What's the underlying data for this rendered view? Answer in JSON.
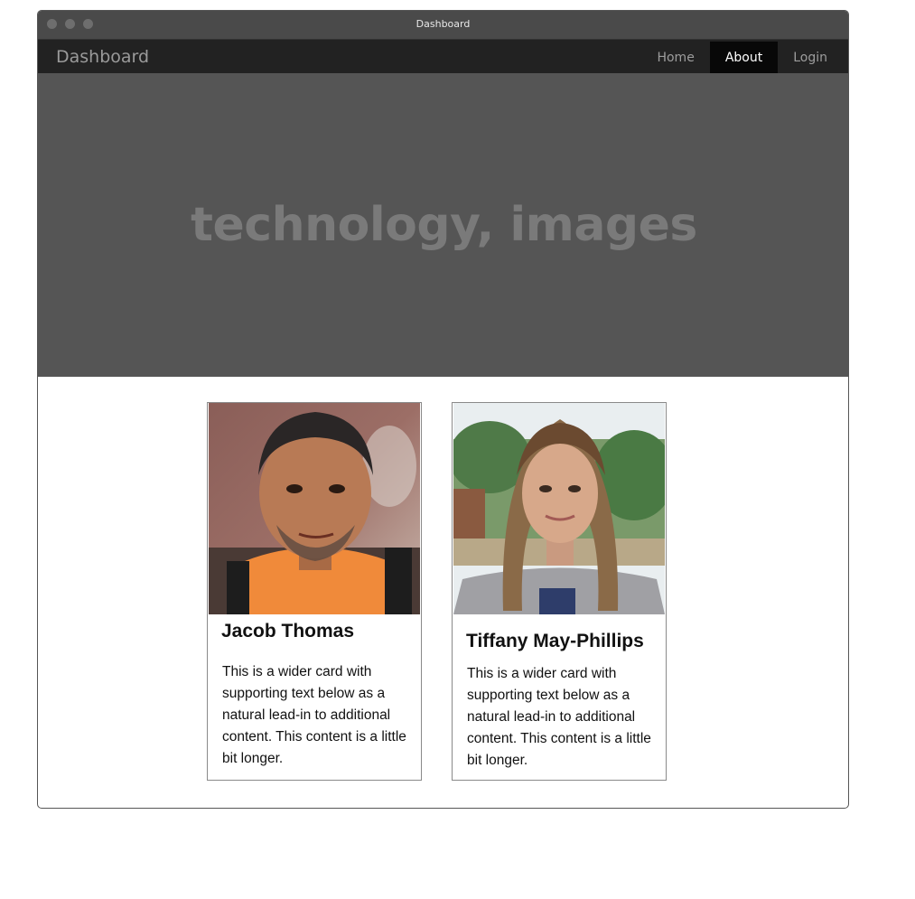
{
  "window": {
    "title": "Dashboard"
  },
  "navbar": {
    "brand": "Dashboard",
    "links": [
      {
        "label": "Home",
        "active": false
      },
      {
        "label": "About",
        "active": true
      },
      {
        "label": "Login",
        "active": false
      }
    ]
  },
  "hero": {
    "text": "technology, images"
  },
  "cards": [
    {
      "name": "Jacob Thomas",
      "text": "This is a wider card with supporting text below as a natural lead-in to additional content. This content is a little bit longer."
    },
    {
      "name": "Tiffany May-Phillips",
      "text": "This is a wider card with supporting text below as a natural lead-in to additional content. This content is a little bit longer."
    }
  ],
  "colors": {
    "titlebar": "#4a4a4a",
    "navbar": "#222222",
    "nav_active": "#080808",
    "hero": "#555555",
    "hero_text": "#7a7a7a"
  }
}
